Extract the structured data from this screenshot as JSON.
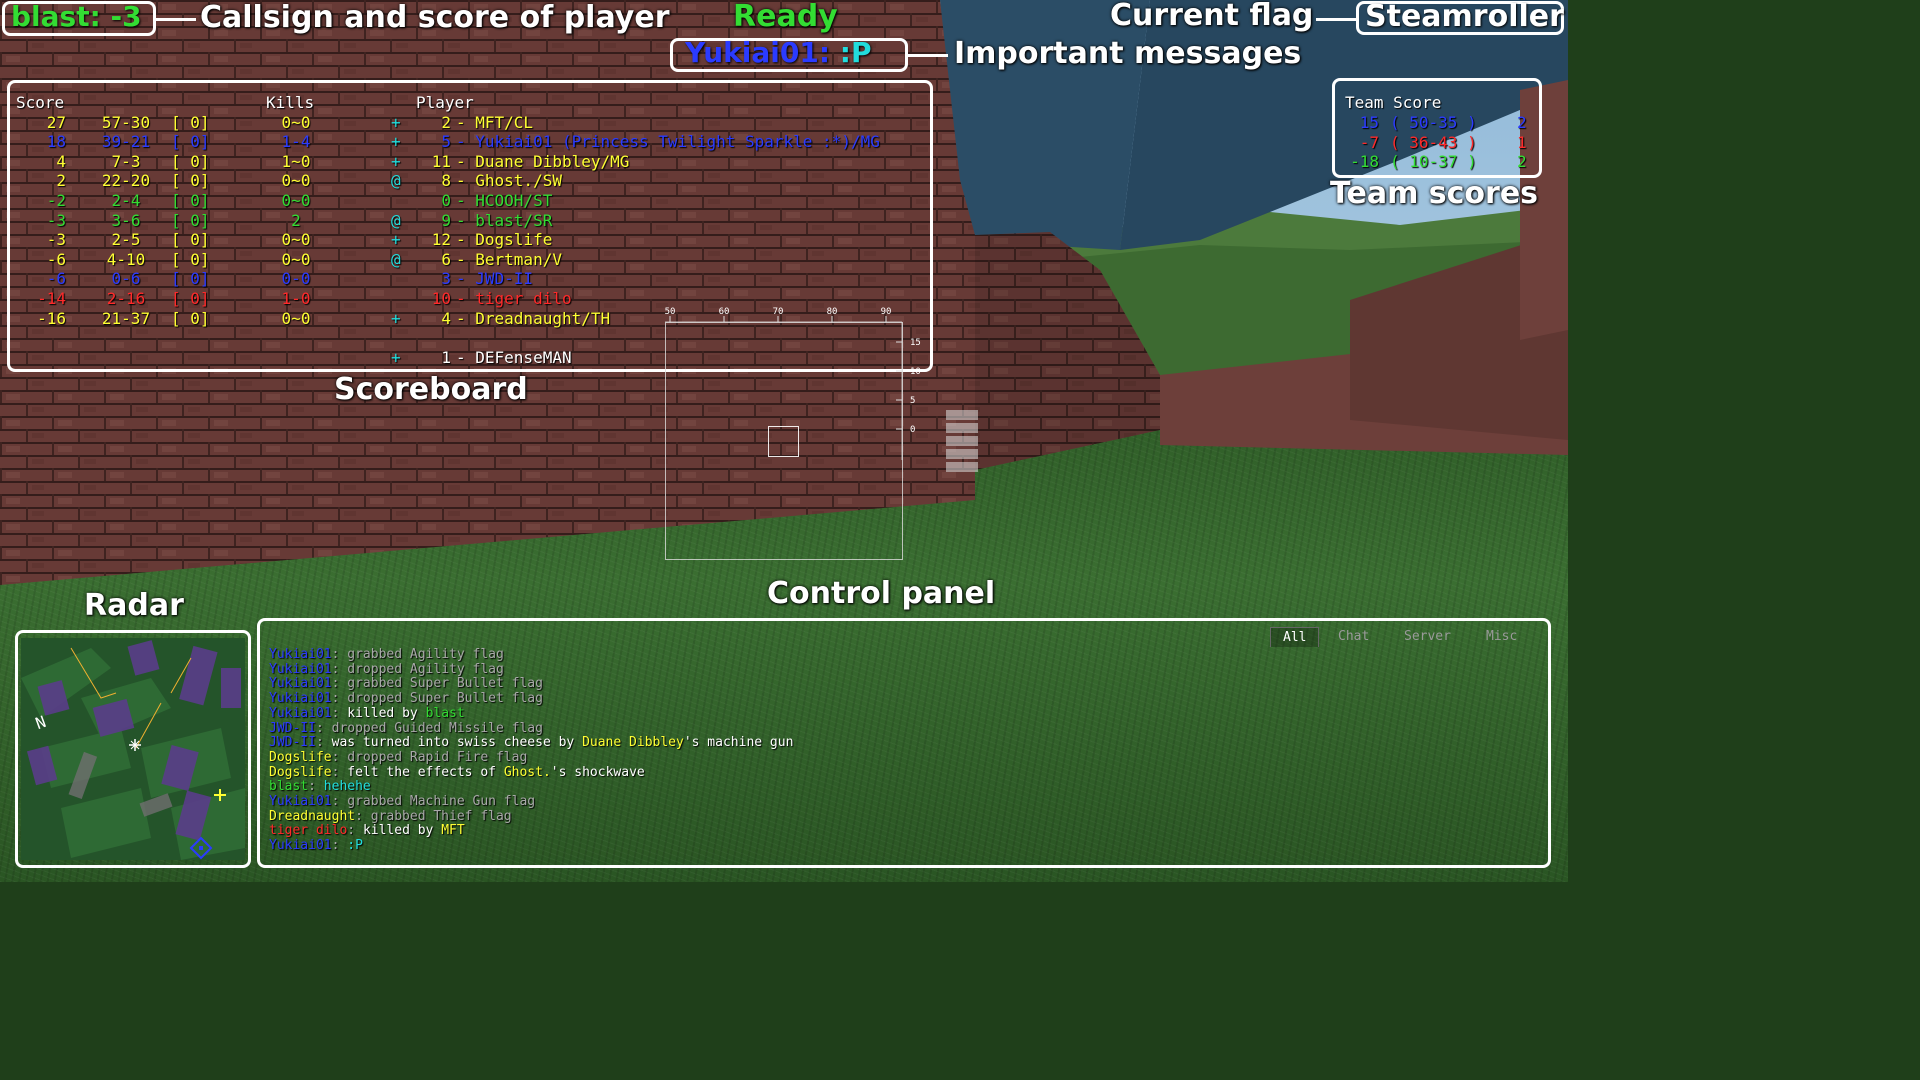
{
  "colors": {
    "green": "#33dd33",
    "yellow": "#ffff33",
    "blue": "#2b3bff",
    "red": "#ff2a2a",
    "cyan": "#22dddd",
    "white": "#ffffff",
    "gray": "#a8a8a8",
    "hud_border": "#ffffff"
  },
  "hud": {
    "callsign_score": "blast: -3",
    "callsign_label": "Callsign and score of player",
    "status": "Ready",
    "message": "Yukiai01: :P",
    "messages_label": "Important messages",
    "current_flag_label": "Current flag",
    "current_flag": "Steamroller",
    "scoreboard_label": "Scoreboard",
    "team_scores_label": "Team scores",
    "radar_label": "Radar",
    "control_panel_label": "Control panel"
  },
  "scoreboard": {
    "headers": {
      "score": "Score",
      "kills": "Kills",
      "player": "Player"
    },
    "rows": [
      {
        "score": "27",
        "wl": "57-30",
        "tk": "[ 0]",
        "kills": "0~0",
        "status": "+",
        "rank": "2",
        "sep": "-",
        "player": "MFT/CL",
        "color": "yellow"
      },
      {
        "score": "18",
        "wl": "39-21",
        "tk": "[ 0]",
        "kills": "1-4",
        "status": "+",
        "rank": "5",
        "sep": "-",
        "player": "Yukiai01 (Princess Twilight Sparkle :*)/MG",
        "color": "blue"
      },
      {
        "score": "4",
        "wl": "7-3",
        "tk": "[ 0]",
        "kills": "1~0",
        "status": "+",
        "rank": "11",
        "sep": "-",
        "player": "Duane Dibbley/MG",
        "color": "yellow"
      },
      {
        "score": "2",
        "wl": "22-20",
        "tk": "[ 0]",
        "kills": "0~0",
        "status": "@",
        "rank": "8",
        "sep": "-",
        "player": "Ghost./SW",
        "color": "yellow"
      },
      {
        "score": "-2",
        "wl": "2-4",
        "tk": "[ 0]",
        "kills": "0~0",
        "status": "",
        "rank": "0",
        "sep": "-",
        "player": "HCOOH/ST",
        "color": "green"
      },
      {
        "score": "-3",
        "wl": "3-6",
        "tk": "[ 0]",
        "kills": "2",
        "status": "@",
        "rank": "9",
        "sep": "-",
        "player": "blast/SR",
        "color": "green"
      },
      {
        "score": "-3",
        "wl": "2-5",
        "tk": "[ 0]",
        "kills": "0~0",
        "status": "+",
        "rank": "12",
        "sep": "-",
        "player": "Dogslife",
        "color": "yellow"
      },
      {
        "score": "-6",
        "wl": "4-10",
        "tk": "[ 0]",
        "kills": "0~0",
        "status": "@",
        "rank": "6",
        "sep": "-",
        "player": "Bertman/V",
        "color": "yellow"
      },
      {
        "score": "-6",
        "wl": "0-6",
        "tk": "[ 0]",
        "kills": "0-0",
        "status": "",
        "rank": "3",
        "sep": "-",
        "player": "JWD-II",
        "color": "blue"
      },
      {
        "score": "-14",
        "wl": "2-16",
        "tk": "[ 0]",
        "kills": "1-0",
        "status": "",
        "rank": "10",
        "sep": "-",
        "player": "tiger dilo",
        "color": "red"
      },
      {
        "score": "-16",
        "wl": "21-37",
        "tk": "[ 0]",
        "kills": "0~0",
        "status": "+",
        "rank": "4",
        "sep": "-",
        "player": "Dreadnaught/TH",
        "color": "yellow"
      },
      {
        "score": "",
        "wl": "",
        "tk": "",
        "kills": "",
        "status": "+",
        "rank": "1",
        "sep": "-",
        "player": "DEFenseMAN",
        "color": "white"
      }
    ]
  },
  "team_scores": {
    "header": "Team Score",
    "rows": [
      {
        "score": "15",
        "detail": "( 50-35 )",
        "count": "2",
        "color": "blue"
      },
      {
        "score": "-7",
        "detail": "( 36-43 )",
        "count": "1",
        "color": "red"
      },
      {
        "score": "-18",
        "detail": "( 10-37 )",
        "count": "2",
        "color": "green"
      }
    ]
  },
  "sight": {
    "x_ticks": [
      "50",
      "60",
      "70",
      "80",
      "90"
    ],
    "y_ticks": [
      "15",
      "10",
      "5",
      "0"
    ]
  },
  "control_panel": {
    "tabs": [
      {
        "label": "All",
        "active": true
      },
      {
        "label": "Chat",
        "active": false
      },
      {
        "label": "Server",
        "active": false
      },
      {
        "label": "Misc",
        "active": false
      }
    ],
    "messages": [
      [
        {
          "t": "Yukiai01",
          "c": "blue"
        },
        {
          "t": ": grabbed Agility flag",
          "c": "gray"
        }
      ],
      [
        {
          "t": "Yukiai01",
          "c": "blue"
        },
        {
          "t": ": dropped Agility flag",
          "c": "gray"
        }
      ],
      [
        {
          "t": "Yukiai01",
          "c": "blue"
        },
        {
          "t": ": grabbed Super Bullet flag",
          "c": "gray"
        }
      ],
      [
        {
          "t": "Yukiai01",
          "c": "blue"
        },
        {
          "t": ": dropped Super Bullet flag",
          "c": "gray"
        }
      ],
      [
        {
          "t": "Yukiai01",
          "c": "blue"
        },
        {
          "t": ": ",
          "c": "gray"
        },
        {
          "t": "killed by ",
          "c": "white"
        },
        {
          "t": "blast",
          "c": "green"
        }
      ],
      [
        {
          "t": "JWD-II",
          "c": "blue"
        },
        {
          "t": ": dropped Guided Missile flag",
          "c": "gray"
        }
      ],
      [
        {
          "t": "JWD-II",
          "c": "blue"
        },
        {
          "t": ": ",
          "c": "gray"
        },
        {
          "t": "was turned into swiss cheese by ",
          "c": "white"
        },
        {
          "t": "Duane Dibbley",
          "c": "yellow"
        },
        {
          "t": "'s machine gun",
          "c": "white"
        }
      ],
      [
        {
          "t": "Dogslife",
          "c": "yellow"
        },
        {
          "t": ": dropped Rapid Fire flag",
          "c": "gray"
        }
      ],
      [
        {
          "t": "Dogslife",
          "c": "yellow"
        },
        {
          "t": ": ",
          "c": "gray"
        },
        {
          "t": "felt the effects of ",
          "c": "white"
        },
        {
          "t": "Ghost.",
          "c": "yellow"
        },
        {
          "t": "'s shockwave",
          "c": "white"
        }
      ],
      [
        {
          "t": "blast",
          "c": "green"
        },
        {
          "t": ": ",
          "c": "gray"
        },
        {
          "t": "hehehe",
          "c": "cyan"
        }
      ],
      [
        {
          "t": "Yukiai01",
          "c": "blue"
        },
        {
          "t": ": grabbed Machine Gun flag",
          "c": "gray"
        }
      ],
      [
        {
          "t": "Dreadnaught",
          "c": "yellow"
        },
        {
          "t": ": grabbed Thief flag",
          "c": "gray"
        }
      ],
      [
        {
          "t": "tiger dilo",
          "c": "red"
        },
        {
          "t": ": ",
          "c": "gray"
        },
        {
          "t": "killed by ",
          "c": "white"
        },
        {
          "t": "MFT",
          "c": "yellow"
        }
      ],
      [
        {
          "t": "Yukiai01",
          "c": "blue"
        },
        {
          "t": ": ",
          "c": "gray"
        },
        {
          "t": ":P",
          "c": "cyan"
        }
      ]
    ]
  },
  "radar": {
    "compass_label": "N"
  }
}
